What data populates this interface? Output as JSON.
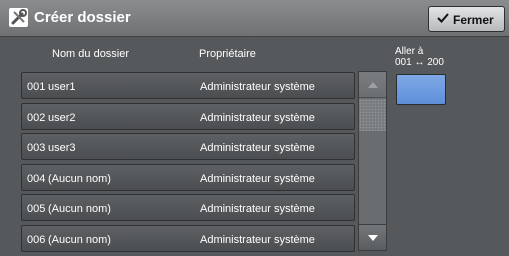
{
  "window": {
    "title": "Créer dossier",
    "close_label": "Fermer",
    "close_icon": "check-icon",
    "title_icon": "tools-icon"
  },
  "table": {
    "headers": {
      "name": "Nom du dossier",
      "owner": "Propriétaire"
    },
    "rows": [
      {
        "number": "001",
        "name": "user1",
        "owner": "Administrateur système"
      },
      {
        "number": "002",
        "name": "user2",
        "owner": "Administrateur système"
      },
      {
        "number": "003",
        "name": "user3",
        "owner": "Administrateur système"
      },
      {
        "number": "004",
        "name": "(Aucun nom)",
        "owner": "Administrateur système"
      },
      {
        "number": "005",
        "name": "(Aucun nom)",
        "owner": "Administrateur système"
      },
      {
        "number": "006",
        "name": "(Aucun nom)",
        "owner": "Administrateur système"
      }
    ]
  },
  "goto": {
    "label": "Aller à",
    "range": "001 ↔ 200"
  },
  "colors": {
    "accent": "#6b9ce0",
    "background": "#56595c"
  }
}
